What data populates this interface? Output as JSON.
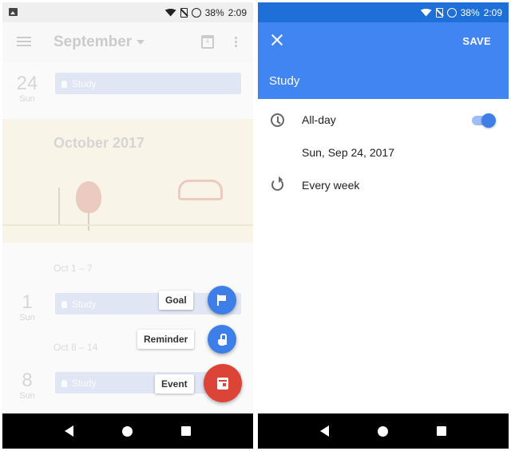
{
  "left": {
    "status": {
      "battery": "38%",
      "time": "2:09",
      "icons": [
        "gallery-icon",
        "wifi-icon",
        "no-sim-icon",
        "battery-saver-icon"
      ]
    },
    "appbar": {
      "month": "September",
      "today_icon_day": "4"
    },
    "events": [
      {
        "day_num": "24",
        "day_dow": "Sun",
        "title": "Study"
      },
      {
        "day_num": "1",
        "day_dow": "Sun",
        "title": "Study"
      },
      {
        "day_num": "8",
        "day_dow": "Sun",
        "title": "Study"
      }
    ],
    "month_banner": "October 2017",
    "weeks": [
      "Oct 1 – 7",
      "Oct 8 – 14"
    ],
    "speed_dial": {
      "goal": "Goal",
      "reminder": "Reminder",
      "event": "Event"
    },
    "colors": {
      "fab_blue": "#3d7ee8",
      "fab_red": "#dc4437"
    }
  },
  "right": {
    "status": {
      "battery": "38%",
      "time": "2:09"
    },
    "header": {
      "save_label": "SAVE",
      "event_title": "Study"
    },
    "rows": {
      "all_day_label": "All-day",
      "all_day_on": true,
      "date": "Sun, Sep 24, 2017",
      "repeat": "Every week"
    },
    "colors": {
      "header": "#4185f2",
      "status": "#1e6fd8"
    }
  }
}
